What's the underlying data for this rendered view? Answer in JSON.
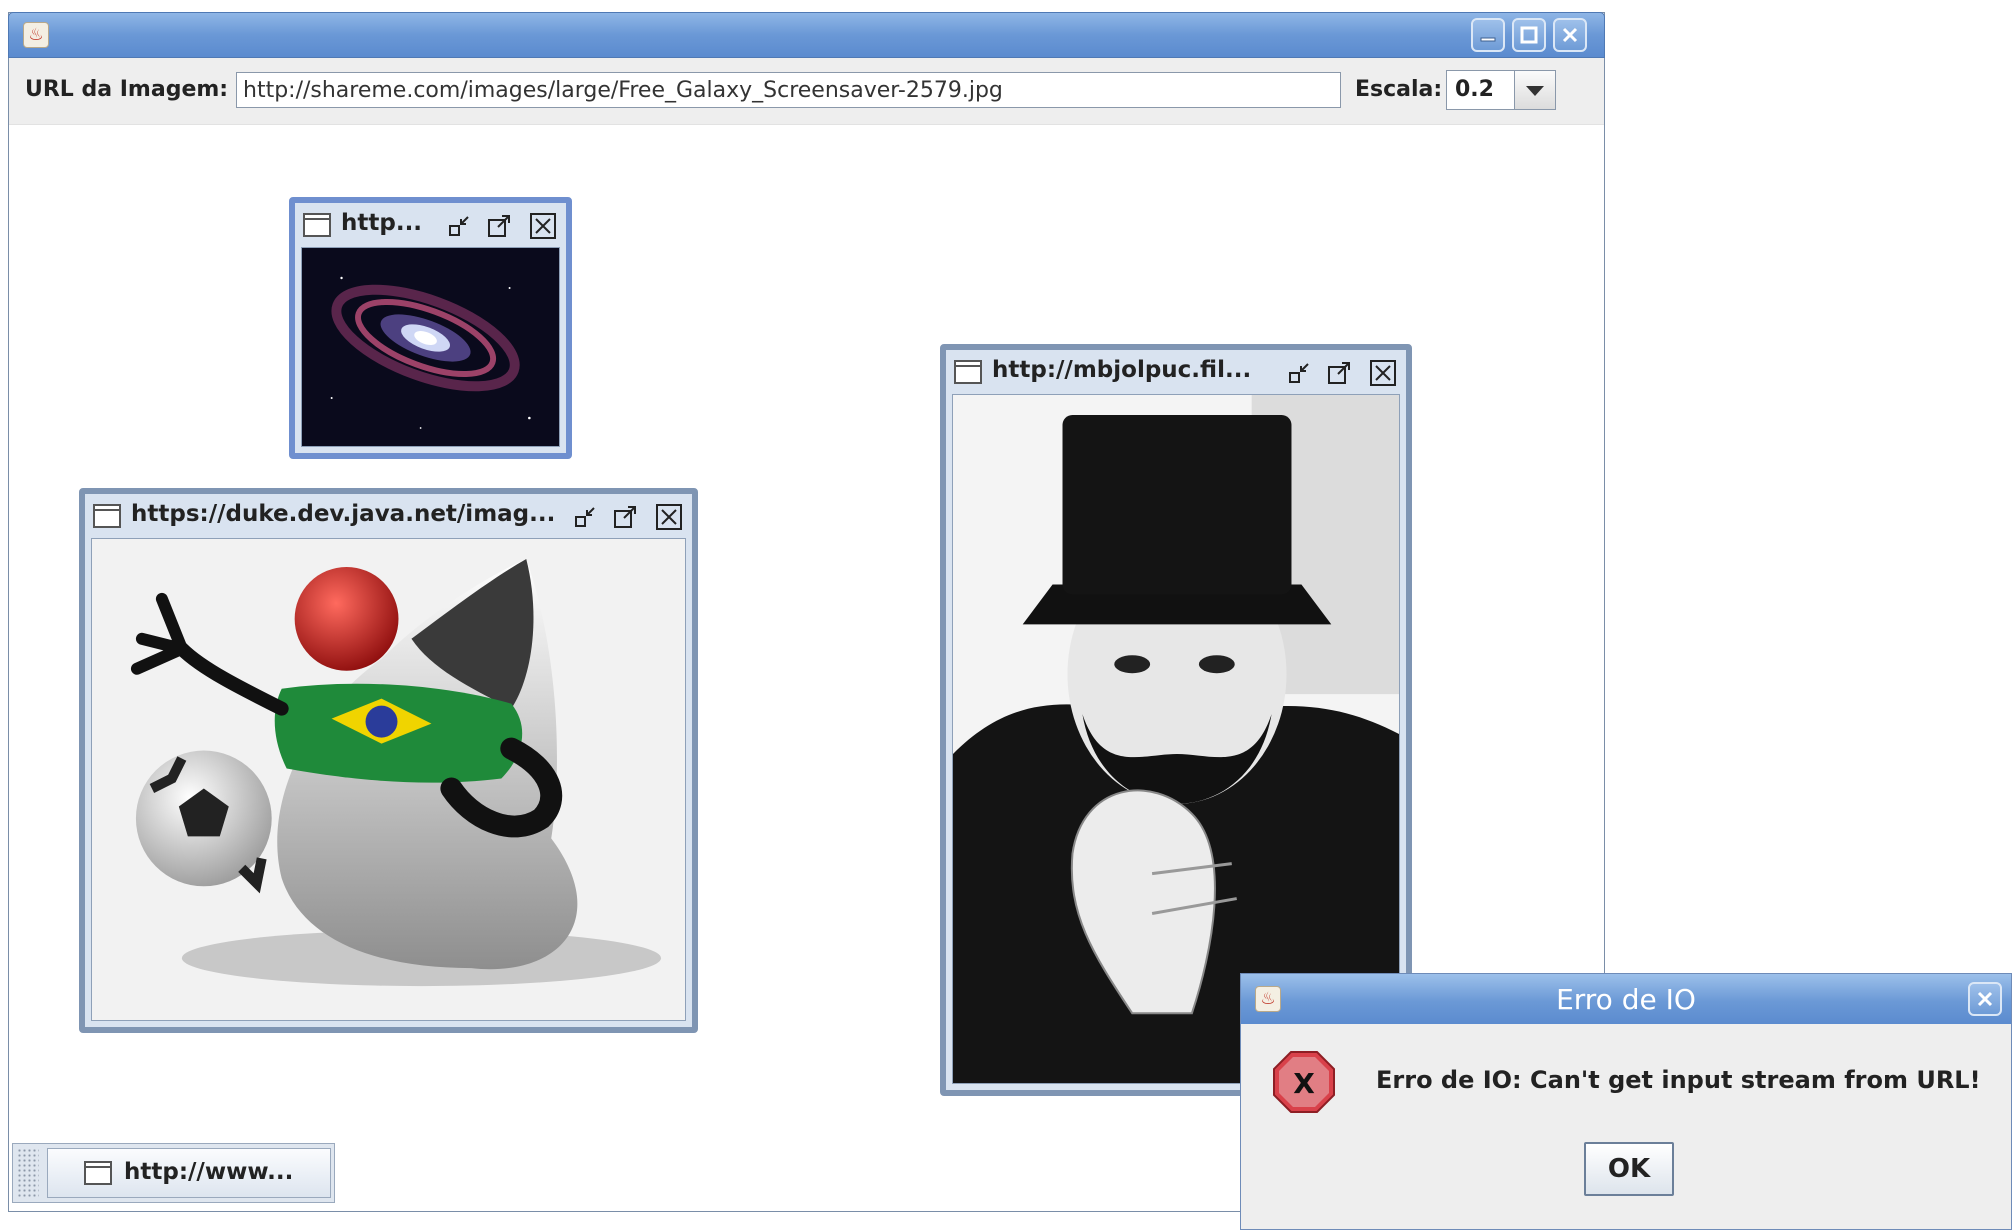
{
  "toolbar": {
    "url_label": "URL da Imagem:",
    "url_value": "http://shareme.com/images/large/Free_Galaxy_Screensaver-2579.jpg",
    "scale_label": "Escala:",
    "scale_value": "0.2"
  },
  "internal_frames": [
    {
      "title": "http...",
      "image": "spiral galaxy"
    },
    {
      "title": "https://duke.dev.java.net/imag...",
      "image": "Duke mascot in Brazil shirt with soccer ball"
    },
    {
      "title": "http://mbjolpuc.fil...",
      "image": "man with top hat and beard"
    }
  ],
  "taskbar": {
    "minimized_frame_title": "http://www..."
  },
  "dialog": {
    "title": "Erro de IO",
    "message": "Erro de IO: Can't get input stream from URL!",
    "ok_label": "OK"
  },
  "colors": {
    "titlebar_blue": "#6a98d6",
    "panel_gray": "#eeeeee",
    "error_red": "#d9414a"
  }
}
